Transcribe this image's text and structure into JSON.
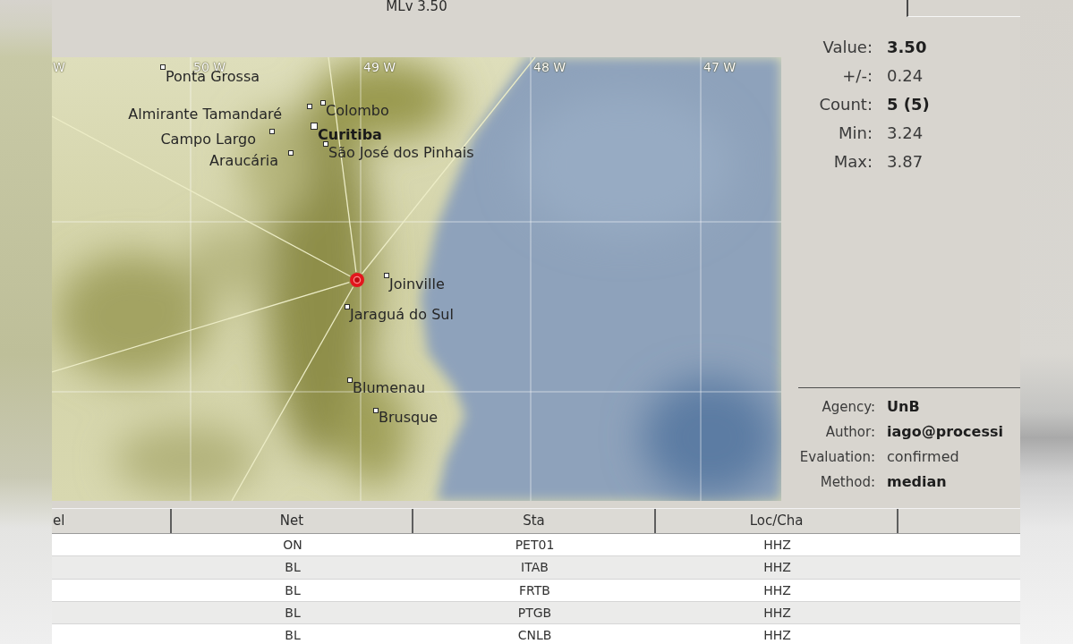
{
  "header": {
    "title": "MLv 3.50"
  },
  "map": {
    "grid_labels": [
      "W",
      "50 W",
      "49 W",
      "48 W",
      "47 W"
    ],
    "cities": [
      {
        "name": "Ponta Grossa",
        "kind": "city"
      },
      {
        "name": "Almirante Tamandaré",
        "kind": "city"
      },
      {
        "name": "Colombo",
        "kind": "city"
      },
      {
        "name": "Campo Largo",
        "kind": "city"
      },
      {
        "name": "Curitiba",
        "kind": "capital"
      },
      {
        "name": "Araucária",
        "kind": "city"
      },
      {
        "name": "São José dos Pinhais",
        "kind": "city"
      },
      {
        "name": "Joinville",
        "kind": "city"
      },
      {
        "name": "Jaraguá do Sul",
        "kind": "city"
      },
      {
        "name": "Blumenau",
        "kind": "city"
      },
      {
        "name": "Brusque",
        "kind": "city"
      }
    ]
  },
  "summary": [
    {
      "label": "Value:",
      "value": "3.50",
      "bold": true
    },
    {
      "label": "+/-:",
      "value": "0.24",
      "bold": false
    },
    {
      "label": "Count:",
      "value": "5 (5)",
      "bold": true
    },
    {
      "label": "Min:",
      "value": "3.24",
      "bold": false
    },
    {
      "label": "Max:",
      "value": "3.87",
      "bold": false
    }
  ],
  "origin": [
    {
      "label": "Agency:",
      "value": "UnB",
      "bold": true
    },
    {
      "label": "Author:",
      "value": "iago@processi",
      "bold": true
    },
    {
      "label": "Evaluation:",
      "value": "confirmed",
      "bold": false
    },
    {
      "label": "Method:",
      "value": "median",
      "bold": true
    }
  ],
  "table": {
    "columns": [
      "el",
      "Net",
      "Sta",
      "Loc/Cha"
    ],
    "rows": [
      {
        "net": "ON",
        "sta": "PET01",
        "loc_cha": "HHZ"
      },
      {
        "net": "BL",
        "sta": "ITAB",
        "loc_cha": "HHZ"
      },
      {
        "net": "BL",
        "sta": "FRTB",
        "loc_cha": "HHZ"
      },
      {
        "net": "BL",
        "sta": "PTGB",
        "loc_cha": "HHZ"
      },
      {
        "net": "BL",
        "sta": "CNLB",
        "loc_cha": "HHZ"
      }
    ]
  }
}
